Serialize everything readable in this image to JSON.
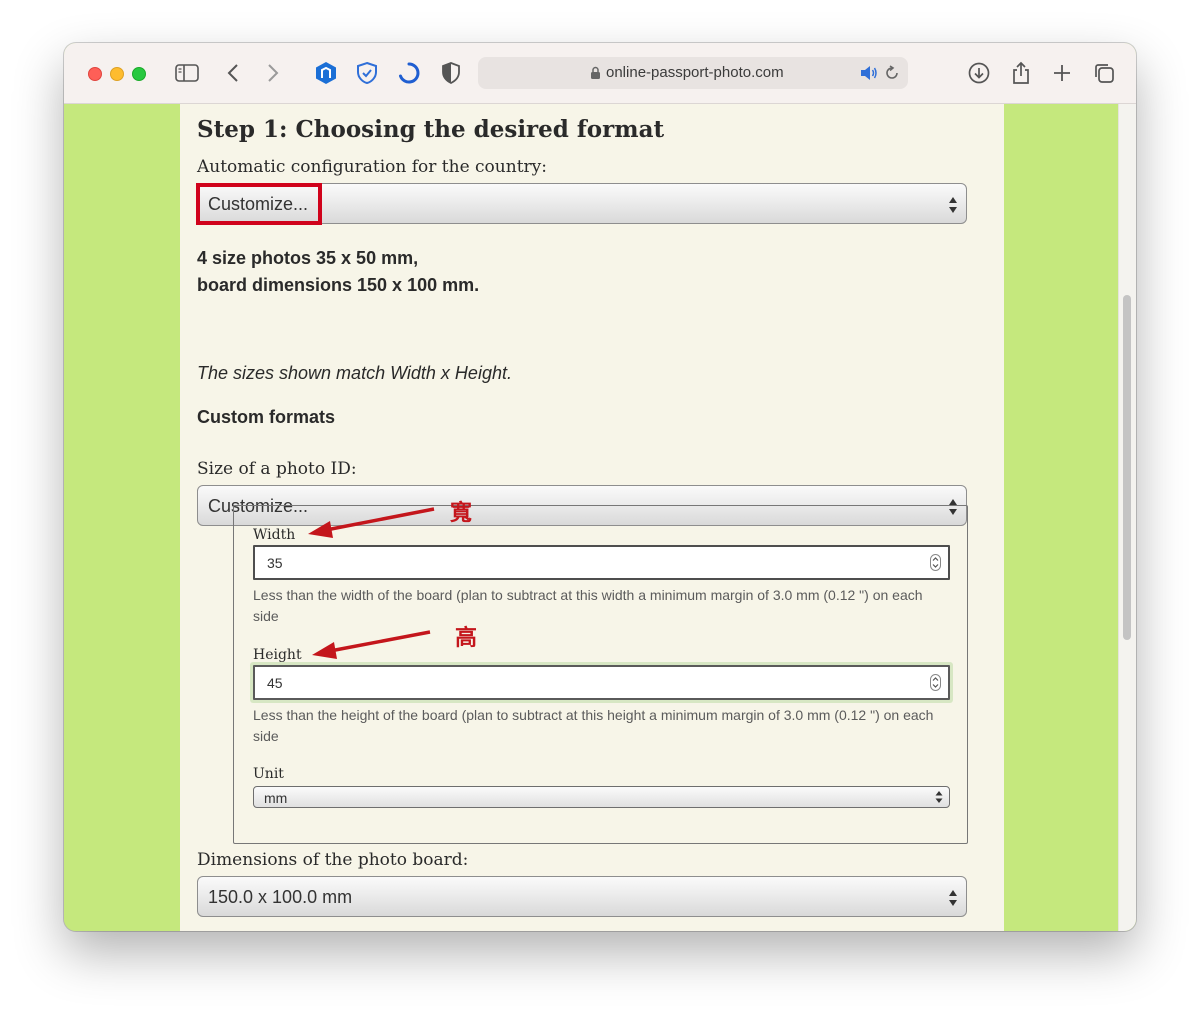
{
  "browser": {
    "url": "online-passport-photo.com"
  },
  "page": {
    "step_title": "Step 1: Choosing the desired format",
    "country_label": "Automatic configuration for the country:",
    "country_select_value": "Customize...",
    "summary_line1": "4 size photos 35 x 50 mm,",
    "summary_line2": "board dimensions 150 x 100 mm.",
    "sizes_note": "The sizes shown match Width x Height.",
    "custom_formats_heading": "Custom formats",
    "photo_id_label": "Size of a photo ID:",
    "photo_id_select_value": "Customize...",
    "width_label": "Width",
    "width_value": "35",
    "width_help": "Less than the width of the board (plan to subtract at this width a minimum margin of 3.0 mm (0.12 \") on each side",
    "height_label": "Height",
    "height_value": "45",
    "height_help": "Less than the height of the board (plan to subtract at this height a minimum margin of 3.0 mm (0.12 \") on each side",
    "unit_label": "Unit",
    "unit_value": "mm",
    "board_label": "Dimensions of the photo board:",
    "board_select_value": "150.0 x 100.0 mm"
  },
  "annotations": {
    "width_char": "寬",
    "height_char": "高",
    "color": "#c4161c"
  },
  "colors": {
    "page_bg": "#f7f5e8",
    "side_bg": "#c5e87d",
    "highlight": "#d0021b"
  }
}
